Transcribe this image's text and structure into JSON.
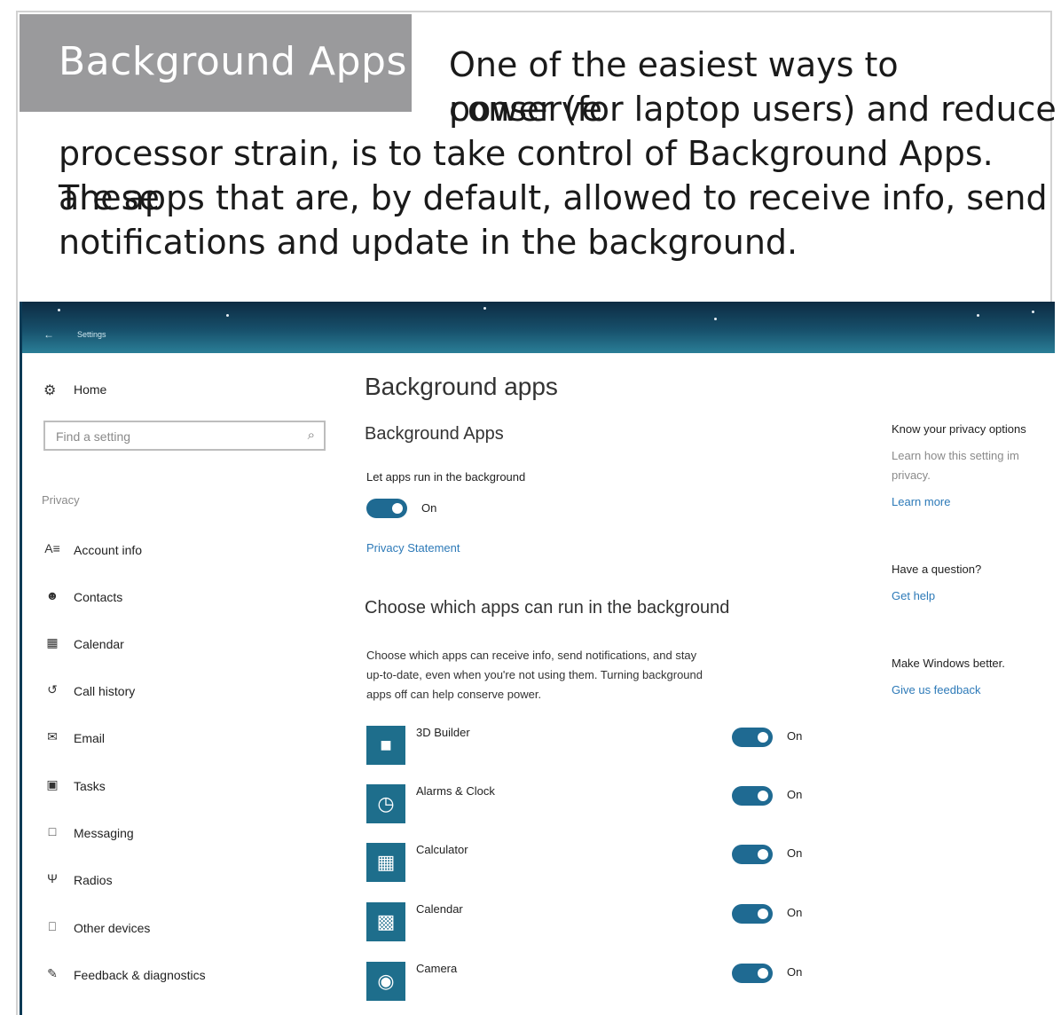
{
  "header": {
    "tag": "Background Apps",
    "intro_lines": [
      "One of the easiest ways to conserve",
      "power (for laptop users) and reduce",
      "processor strain, is to take control of Background Apps. These",
      "are apps that are, by default, allowed to receive info, send",
      "notifications and update in the background."
    ]
  },
  "window": {
    "back_icon": "back-arrow-icon",
    "title": "Settings"
  },
  "sidebar": {
    "home_label": "Home",
    "search_placeholder": "Find a setting",
    "section_label": "Privacy",
    "items": [
      {
        "label": "Account info",
        "icon": "account-info-icon"
      },
      {
        "label": "Contacts",
        "icon": "contacts-icon"
      },
      {
        "label": "Calendar",
        "icon": "calendar-icon"
      },
      {
        "label": "Call history",
        "icon": "call-history-icon"
      },
      {
        "label": "Email",
        "icon": "email-icon"
      },
      {
        "label": "Tasks",
        "icon": "tasks-icon"
      },
      {
        "label": "Messaging",
        "icon": "messaging-icon"
      },
      {
        "label": "Radios",
        "icon": "radios-icon"
      },
      {
        "label": "Other devices",
        "icon": "other-devices-icon"
      },
      {
        "label": "Feedback & diagnostics",
        "icon": "feedback-icon"
      }
    ]
  },
  "main": {
    "title": "Background apps",
    "subtitle": "Background Apps",
    "let_apps_label": "Let apps run in the background",
    "toggle_state": "On",
    "privacy_link": "Privacy Statement",
    "choose_heading": "Choose which apps can run in the background",
    "choose_desc_lines": [
      "Choose which apps can receive info, send notifications, and stay",
      "up-to-date, even when you're not using them. Turning background",
      "apps off can help conserve power."
    ],
    "apps": [
      {
        "name": "3D Builder",
        "state": "On",
        "icon": "3d-builder-icon"
      },
      {
        "name": "Alarms & Clock",
        "state": "On",
        "icon": "alarm-clock-icon"
      },
      {
        "name": "Calculator",
        "state": "On",
        "icon": "calculator-icon"
      },
      {
        "name": "Calendar",
        "state": "On",
        "icon": "calendar-app-icon"
      },
      {
        "name": "Camera",
        "state": "On",
        "icon": "camera-icon"
      }
    ]
  },
  "right_panel": {
    "privacy_options_heading": "Know your privacy options",
    "privacy_options_text_lines": [
      "Learn how this setting im",
      "privacy."
    ],
    "learn_more": "Learn more",
    "question_heading": "Have a question?",
    "get_help": "Get help",
    "better_heading": "Make Windows better.",
    "feedback_link": "Give us feedback"
  },
  "colors": {
    "tag_bg": "#9a9a9c",
    "accent": "#1f6a92",
    "link": "#2d7ab8",
    "titlebar": "#17506b"
  }
}
